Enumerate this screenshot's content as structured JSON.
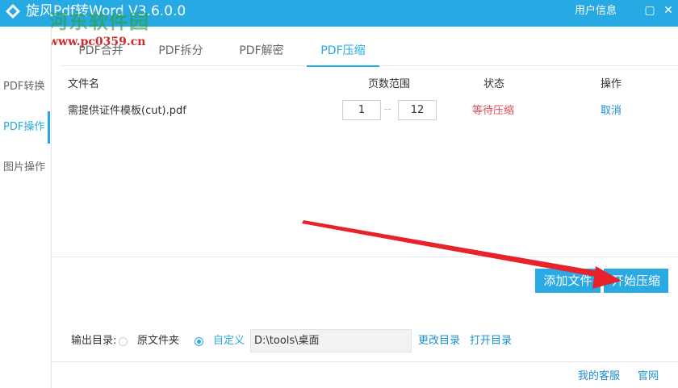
{
  "app": {
    "title": "旋风Pdf转Word V3.6.0.0",
    "user_info": "用户信息",
    "minimize": "▢",
    "close": "✕",
    "watermark_text": "河东软件园",
    "watermark_url": "www.pc0359.cn"
  },
  "sidebar": {
    "items": [
      {
        "label": "PDF转换"
      },
      {
        "label": "PDF操作"
      },
      {
        "label": "图片操作"
      }
    ]
  },
  "tabs": [
    {
      "label": "PDF合并"
    },
    {
      "label": "PDF拆分"
    },
    {
      "label": "PDF解密"
    },
    {
      "label": "PDF压缩"
    }
  ],
  "table": {
    "headers": [
      "文件名",
      "页数范围",
      "状态",
      "操作"
    ],
    "rows": [
      {
        "filename": "需提供证件模板(cut).pdf",
        "page_from": "1",
        "page_sep": "--",
        "page_to": "12",
        "status": "等待压缩",
        "action": "取消"
      }
    ]
  },
  "buttons": {
    "add_file": "添加文件",
    "start": "开始压缩"
  },
  "output": {
    "label": "输出目录:",
    "option_original": "原文件夹",
    "option_custom": "自定义",
    "path": "D:\\tools\\桌面",
    "change_dir": "更改目录",
    "open_dir": "打开目录"
  },
  "footer": {
    "support": "我的客服",
    "website": "官网"
  },
  "colors": {
    "accent": "#27a9e3",
    "status": "#e04b5a",
    "annotation_arrow": "#e8222a"
  }
}
